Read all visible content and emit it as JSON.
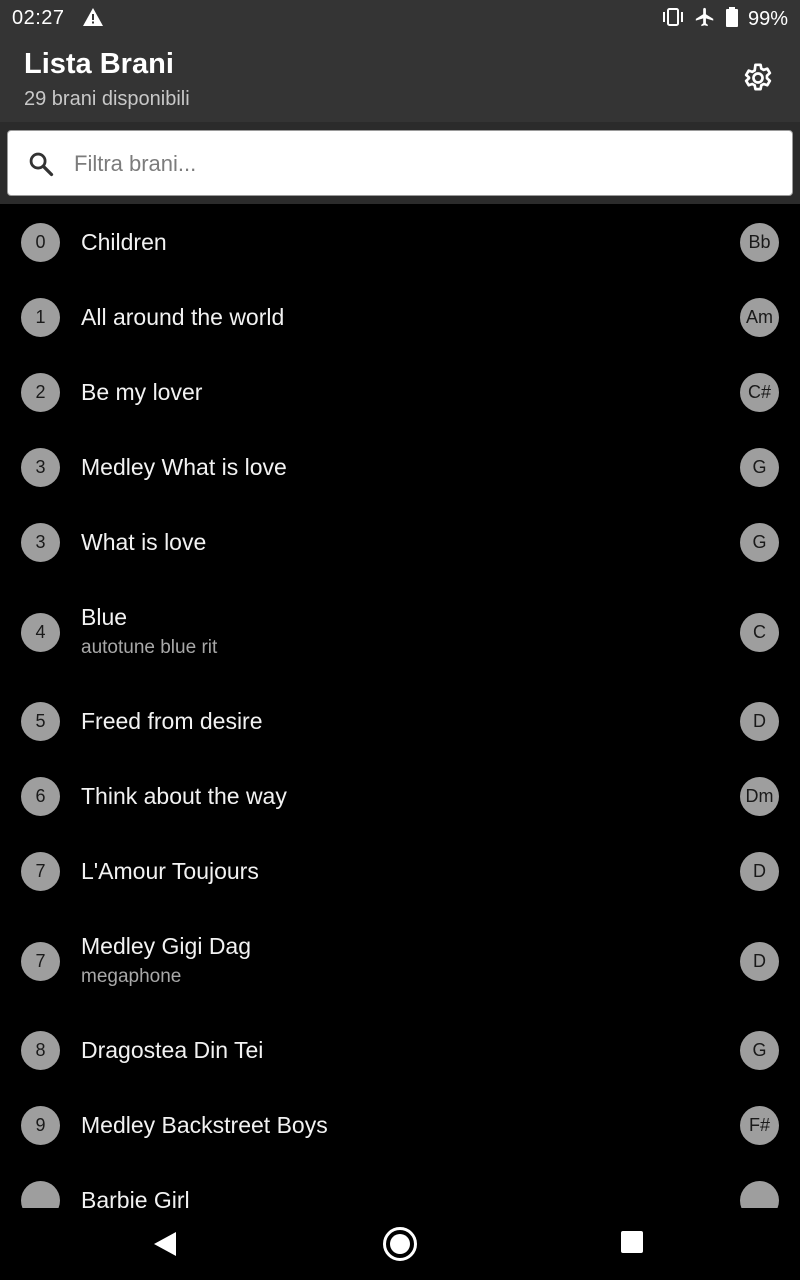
{
  "status": {
    "time": "02:27",
    "battery": "99%"
  },
  "header": {
    "title": "Lista Brani",
    "subtitle": "29 brani disponibili"
  },
  "search": {
    "placeholder": "Filtra brani..."
  },
  "songs": [
    {
      "number": "0",
      "title": "Children",
      "subtitle": "",
      "key": "Bb"
    },
    {
      "number": "1",
      "title": "All around the world",
      "subtitle": "",
      "key": "Am"
    },
    {
      "number": "2",
      "title": "Be my lover",
      "subtitle": "",
      "key": "C#"
    },
    {
      "number": "3",
      "title": "Medley What is love",
      "subtitle": "",
      "key": "G"
    },
    {
      "number": "3",
      "title": "What is love",
      "subtitle": "",
      "key": "G"
    },
    {
      "number": "4",
      "title": "Blue",
      "subtitle": "autotune blue rit",
      "key": "C"
    },
    {
      "number": "5",
      "title": "Freed from desire",
      "subtitle": "",
      "key": "D"
    },
    {
      "number": "6",
      "title": "Think about the way",
      "subtitle": "",
      "key": "Dm"
    },
    {
      "number": "7",
      "title": "L'Amour Toujours",
      "subtitle": "",
      "key": "D"
    },
    {
      "number": "7",
      "title": "Medley Gigi Dag",
      "subtitle": "megaphone",
      "key": "D"
    },
    {
      "number": "8",
      "title": "Dragostea Din Tei",
      "subtitle": "",
      "key": "G"
    },
    {
      "number": "9",
      "title": "Medley Backstreet Boys",
      "subtitle": "",
      "key": "F#"
    },
    {
      "number": "",
      "title": "Barbie Girl",
      "subtitle": "",
      "key": ""
    }
  ],
  "icons": {
    "warning": "warning-icon",
    "vibrate": "vibrate-icon",
    "airplane": "airplane-mode-icon",
    "battery": "battery-icon",
    "settings": "gear-icon",
    "search": "search-icon",
    "back": "back-icon",
    "home": "home-icon",
    "recents": "recents-icon"
  },
  "colors": {
    "appbar": "#343434",
    "background": "#000000",
    "badge": "#9e9e9e"
  }
}
